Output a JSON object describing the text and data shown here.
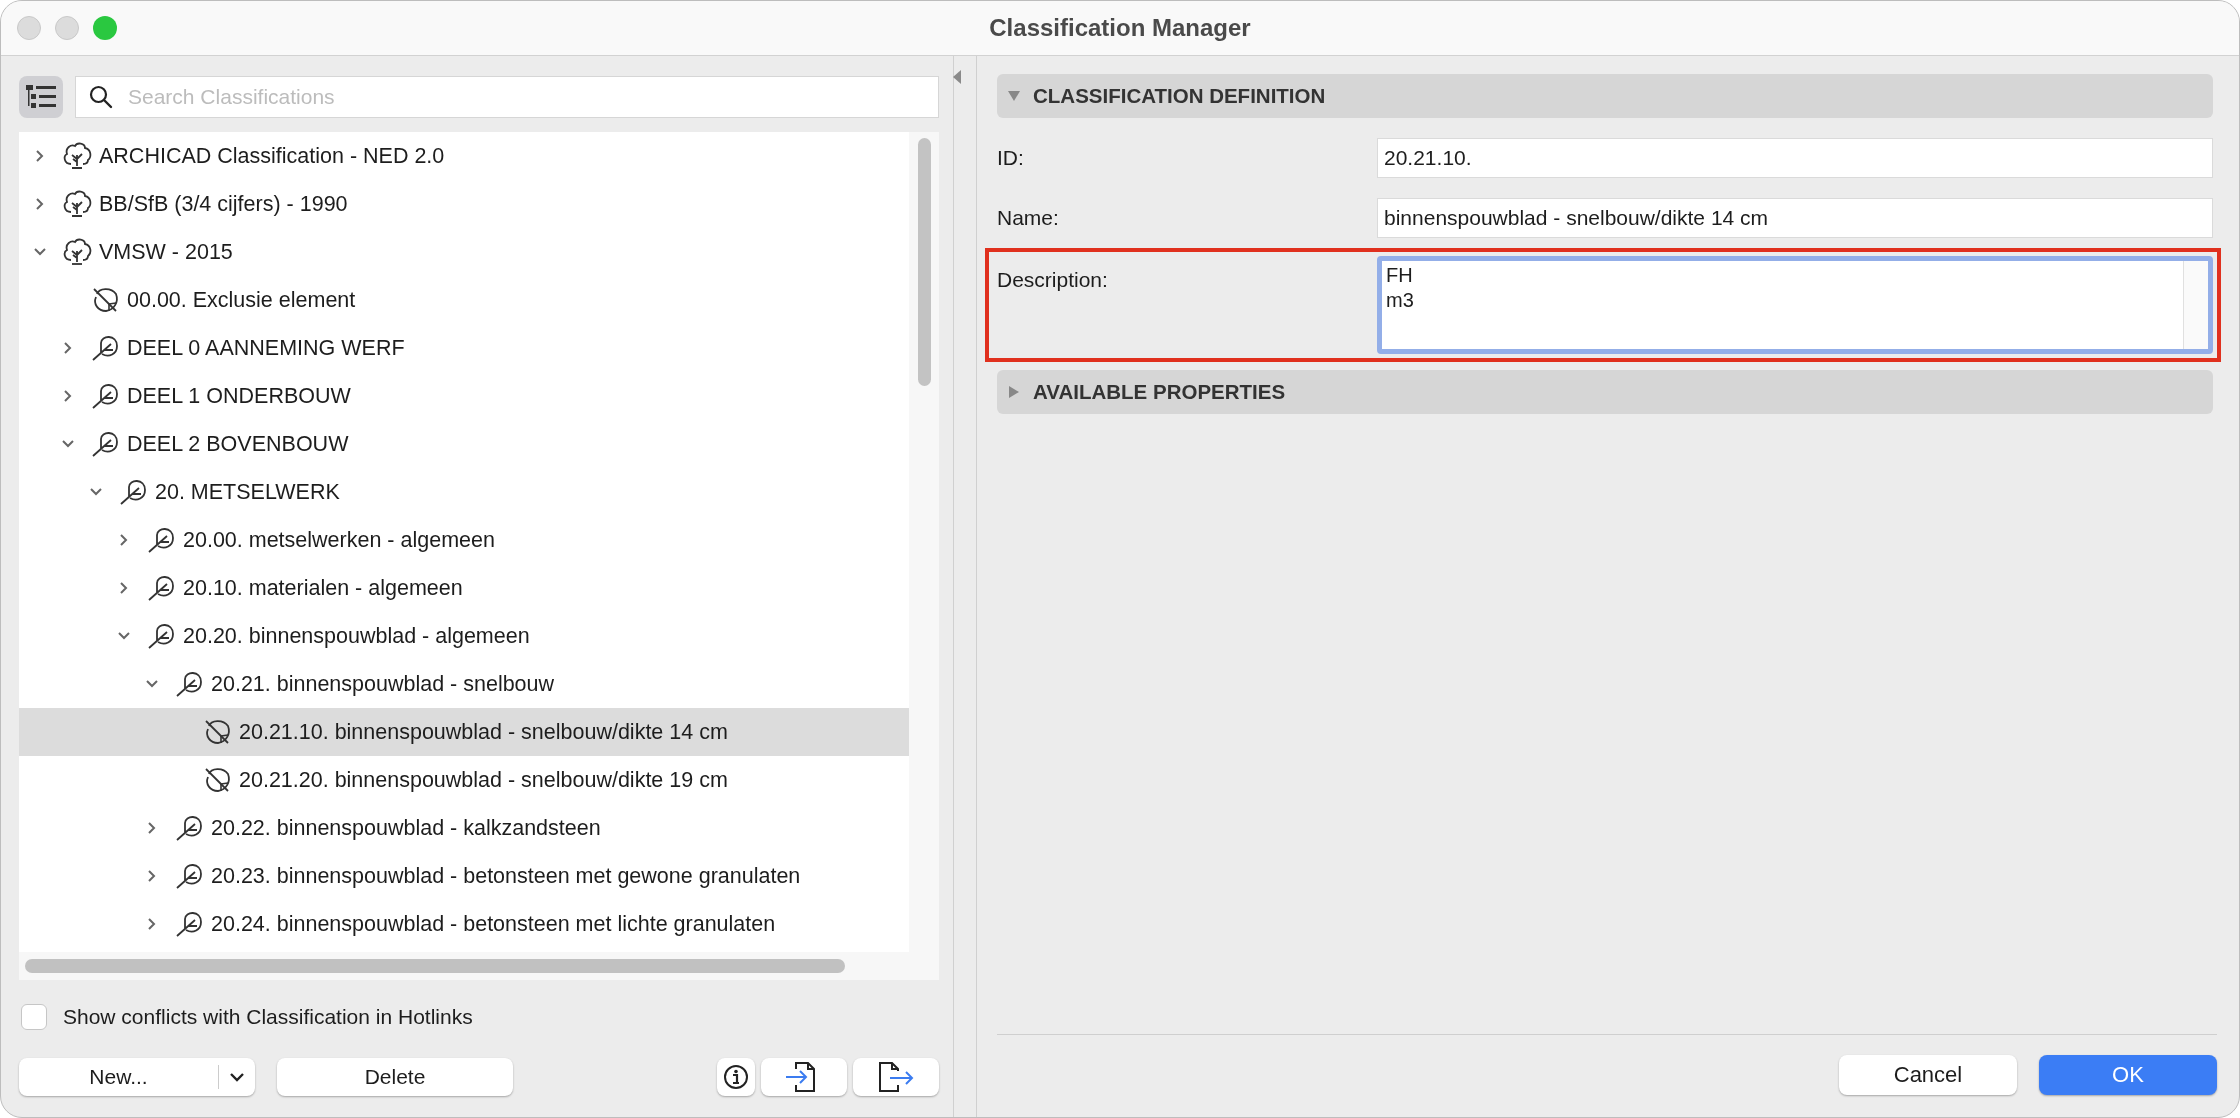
{
  "window": {
    "title": "Classification Manager"
  },
  "search": {
    "placeholder": "Search Classifications"
  },
  "tree": [
    {
      "label": "ARCHICAD Classification - NED 2.0",
      "kind": "system",
      "expanded": false,
      "selected": false
    },
    {
      "label": "BB/SfB (3/4 cijfers) - 1990",
      "kind": "system",
      "expanded": false,
      "selected": false
    },
    {
      "label": "VMSW - 2015",
      "kind": "system",
      "expanded": true,
      "selected": false,
      "children": [
        {
          "label": "00.00. Exclusie element",
          "kind": "leaf",
          "selected": false
        },
        {
          "label": "DEEL 0 AANNEMING WERF",
          "kind": "branch",
          "expanded": false,
          "selected": false
        },
        {
          "label": "DEEL 1 ONDERBOUW",
          "kind": "branch",
          "expanded": false,
          "selected": false
        },
        {
          "label": "DEEL 2 BOVENBOUW",
          "kind": "branch",
          "expanded": true,
          "selected": false,
          "children": [
            {
              "label": "20. METSELWERK",
              "kind": "branch",
              "expanded": true,
              "selected": false,
              "children": [
                {
                  "label": "20.00. metselwerken - algemeen",
                  "kind": "branch",
                  "expanded": false,
                  "selected": false
                },
                {
                  "label": "20.10. materialen - algemeen",
                  "kind": "branch",
                  "expanded": false,
                  "selected": false
                },
                {
                  "label": "20.20. binnenspouwblad - algemeen",
                  "kind": "branch",
                  "expanded": true,
                  "selected": false,
                  "children": [
                    {
                      "label": "20.21. binnenspouwblad - snelbouw",
                      "kind": "branch",
                      "expanded": true,
                      "selected": false,
                      "children": [
                        {
                          "label": "20.21.10. binnenspouwblad - snelbouw/dikte 14 cm",
                          "kind": "leaf",
                          "selected": true
                        },
                        {
                          "label": "20.21.20. binnenspouwblad - snelbouw/dikte 19 cm",
                          "kind": "leaf",
                          "selected": false
                        }
                      ]
                    },
                    {
                      "label": "20.22. binnenspouwblad - kalkzandsteen",
                      "kind": "branch",
                      "expanded": false,
                      "selected": false
                    },
                    {
                      "label": "20.23. binnenspouwblad - betonsteen met gewone granulaten",
                      "kind": "branch",
                      "expanded": false,
                      "selected": false
                    },
                    {
                      "label": "20.24. binnenspouwblad - betonsteen met lichte granulaten",
                      "kind": "branch",
                      "expanded": false,
                      "selected": false
                    }
                  ]
                }
              ]
            }
          ]
        }
      ]
    }
  ],
  "conflicts_checkbox": {
    "label": "Show conflicts with Classification in Hotlinks",
    "checked": false
  },
  "left_buttons": {
    "new": "New...",
    "delete": "Delete"
  },
  "definition": {
    "title": "CLASSIFICATION DEFINITION",
    "expanded": true,
    "fields": [
      {
        "label": "ID:",
        "value": "20.21.10.",
        "kind": "line"
      },
      {
        "label": "Name:",
        "value": "binnenspouwblad - snelbouw/dikte 14 cm",
        "kind": "line"
      },
      {
        "label": "Description:",
        "value": "FH\nm3",
        "kind": "area",
        "highlighted": true,
        "focused": true
      }
    ]
  },
  "properties": {
    "title": "AVAILABLE PROPERTIES",
    "expanded": false
  },
  "dialog_buttons": {
    "cancel": "Cancel",
    "ok": "OK"
  }
}
